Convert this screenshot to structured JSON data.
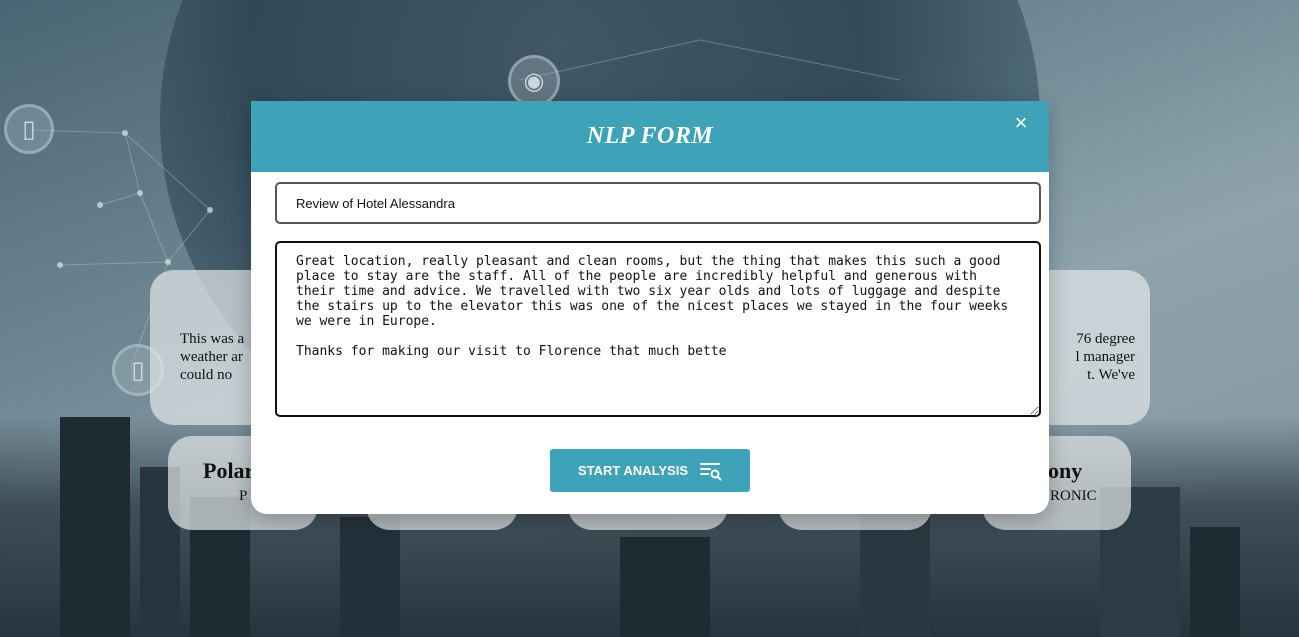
{
  "background": {
    "cards": [
      {
        "text": "This was a\nweather ar\ncould no"
      },
      {
        "text": "76 degree\nl manager\nt. We've"
      }
    ],
    "brand_cards": [
      {
        "title": "Polar",
        "subtitle": "P"
      },
      {
        "title": "ony",
        "subtitle": "RONIC"
      }
    ]
  },
  "modal": {
    "title": "NLP FORM",
    "close_icon": "×",
    "title_field_value": "Review of Hotel Alessandra",
    "review_text": "Great location, really pleasant and clean rooms, but the thing that makes this such a good place to stay are the staff. All of the people are incredibly helpful and generous with their time and advice. We travelled with two six year olds and lots of luggage and despite the stairs up to the elevator this was one of the nicest places we stayed in the four weeks we were in Europe.\n\nThanks for making our visit to Florence that much bette",
    "analyze_button_label": "START ANALYSIS",
    "analyze_button_icon": "list-search-icon",
    "accent_color": "#3ea2b8"
  }
}
